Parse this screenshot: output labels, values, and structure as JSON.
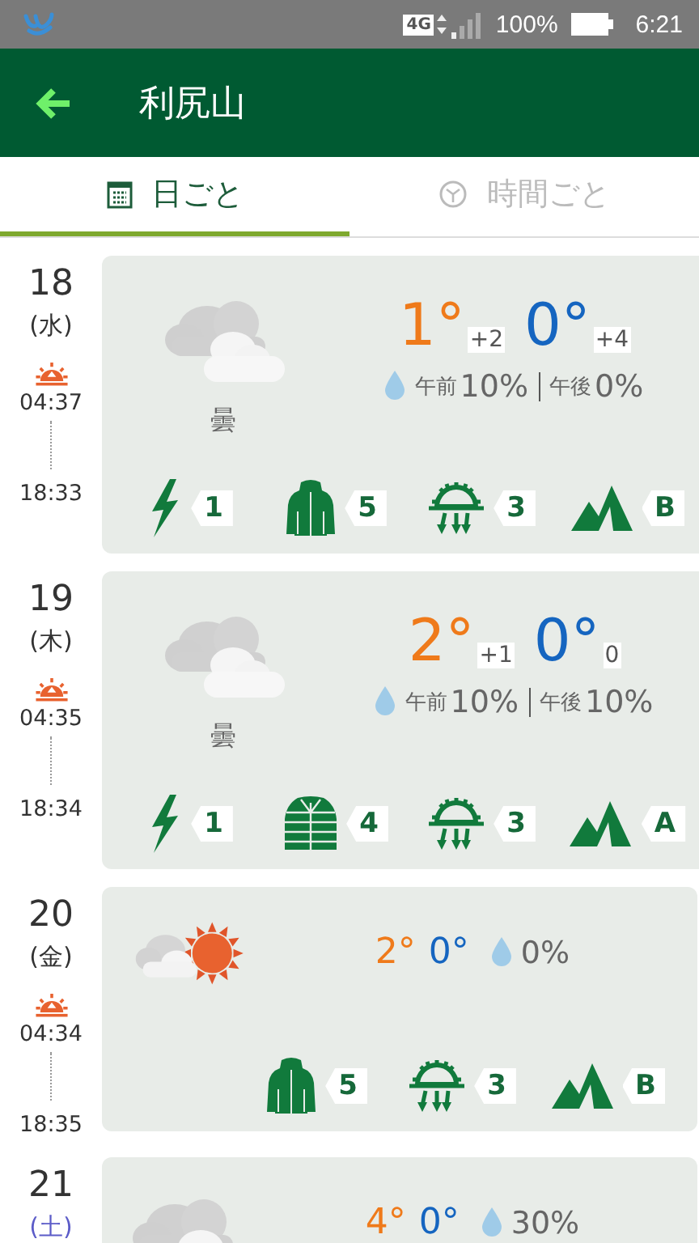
{
  "status_bar": {
    "network": "4G",
    "battery": "100%",
    "time": "6:21"
  },
  "header": {
    "title": "利尻山"
  },
  "tabs": [
    {
      "kind": "calendar",
      "label": "日ごと",
      "selected": true
    },
    {
      "kind": "clock",
      "label": "時間ごと",
      "selected": false
    }
  ],
  "days": [
    {
      "kind": "detailed",
      "date": "18",
      "weekday": "(水)",
      "color": "#333333",
      "sunrise": "04:37",
      "sunset": "18:33",
      "weather": {
        "kind": "cloudy",
        "label": "曇"
      },
      "high": "1°",
      "high_diff": "+2",
      "low": "0°",
      "low_diff": "+4",
      "precip": [
        {
          "label": "午前",
          "value": "10%"
        },
        {
          "label": "午後",
          "value": "0%"
        }
      ],
      "indices": [
        {
          "kind": "thunder",
          "value": "1"
        },
        {
          "kind": "jacket",
          "value": "5"
        },
        {
          "kind": "frost",
          "value": "3"
        },
        {
          "kind": "mountain",
          "value": "B"
        }
      ]
    },
    {
      "kind": "detailed",
      "date": "19",
      "weekday": "(木)",
      "color": "#333333",
      "sunrise": "04:35",
      "sunset": "18:34",
      "weather": {
        "kind": "cloudy",
        "label": "曇"
      },
      "high": "2°",
      "high_diff": "+1",
      "low": "0°",
      "low_diff": "0",
      "precip": [
        {
          "label": "午前",
          "value": "10%"
        },
        {
          "label": "午後",
          "value": "10%"
        }
      ],
      "indices": [
        {
          "kind": "thunder",
          "value": "1"
        },
        {
          "kind": "quilted_jacket",
          "value": "4"
        },
        {
          "kind": "frost",
          "value": "3"
        },
        {
          "kind": "mountain",
          "value": "A"
        }
      ]
    },
    {
      "kind": "compact",
      "date": "20",
      "weekday": "(金)",
      "color": "#333333",
      "sunrise": "04:34",
      "sunset": "18:35",
      "weather": {
        "kind": "cloudy_sun"
      },
      "high": "2°",
      "low": "0°",
      "precip": [
        {
          "value": "0%"
        }
      ],
      "indices": [
        {
          "kind": "jacket",
          "value": "5"
        },
        {
          "kind": "frost",
          "value": "3"
        },
        {
          "kind": "mountain",
          "value": "B"
        }
      ]
    },
    {
      "kind": "compact",
      "date": "21",
      "weekday": "(土)",
      "color": "#5c5cc8",
      "weather": {
        "kind": "cloudy"
      },
      "high": "4°",
      "low": "0°",
      "precip": [
        {
          "value": "30%"
        }
      ]
    }
  ]
}
